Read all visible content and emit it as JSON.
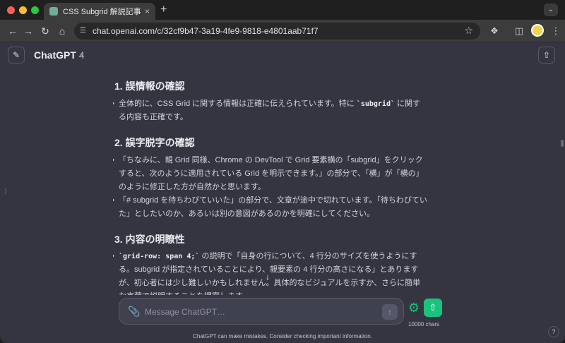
{
  "browser": {
    "tab_title": "CSS Subgrid 解説記事",
    "tab_close": "×",
    "new_tab": "+",
    "url": "chat.openai.com/c/32cf9b47-3a19-4fe9-9818-e4801aab71f7"
  },
  "header": {
    "model_name": "ChatGPT",
    "model_version": "4"
  },
  "sections": [
    {
      "title": "1. 誤情報の確認",
      "bullets": [
        {
          "parts": [
            {
              "t": "全体的に、CSS Grid に関する情報は正確に伝えられています。特に "
            },
            {
              "t": "`subgrid`",
              "code": true
            },
            {
              "t": " に関する内容も正確です。"
            }
          ]
        }
      ]
    },
    {
      "title": "2. 誤字脱字の確認",
      "bullets": [
        {
          "parts": [
            {
              "t": "「ちなみに、親 Grid 同様、Chrome の DevTool で Grid 要素横の「subgrid」をクリックすると、次のように適用されている Grid を明示できます。」の部分で、「横」が「横の」のように修正した方が自然かと思います。"
            }
          ]
        },
        {
          "parts": [
            {
              "t": "「# subgrid を待ちわびていいた」の部分で、文章が途中で切れています。「待ちわびていた」としたいのか、あるいは別の意図があるのかを明確にしてください。"
            }
          ]
        }
      ]
    },
    {
      "title": "3. 内容の明瞭性",
      "bullets": [
        {
          "parts": [
            {
              "t": "`grid-row: span 4;`",
              "code": true
            },
            {
              "t": " の説明で「自身の行について、4 行分のサイズを使うようにする。subgrid が指定されていることにより、親要素の 4 行分の高さになる」とありますが、初心者には少し難しいかもしれません。具体的なビジュアルを示すか、さらに簡単な言葉で説明することを提案します。"
            }
          ]
        }
      ]
    }
  ],
  "composer": {
    "placeholder": "Message ChatGPT…",
    "char_count": "10000 chars"
  },
  "footer": {
    "disclaimer": "ChatGPT can make mistakes. Consider checking important information.",
    "help": "?"
  },
  "colors": {
    "background": "#343541",
    "accent": "#19c37d"
  }
}
